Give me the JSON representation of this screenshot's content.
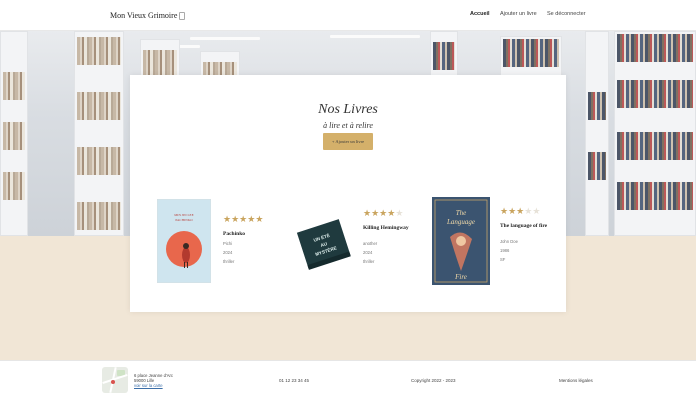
{
  "header": {
    "logo_text": "Mon Vieux Grimoire",
    "nav": [
      {
        "label": "Accueil",
        "active": true
      },
      {
        "label": "Ajouter un livre",
        "active": false
      },
      {
        "label": "Se déconnecter",
        "active": false
      }
    ]
  },
  "hero": {
    "title": "Nos Livres",
    "subtitle": "à lire et à relire",
    "add_button": "+ Ajouter un livre"
  },
  "books": [
    {
      "title": "Pachinko",
      "author": "Pichi",
      "year": "2024",
      "genre": "thriller",
      "rating": 5,
      "cover_text": "MIN JIN LEE PACHINKO"
    },
    {
      "title": "Killing Hemingway",
      "author": "another",
      "year": "2024",
      "genre": "thriller",
      "rating": 4,
      "cover_text": "UN ÉTÉ AU MYSTÈRE"
    },
    {
      "title": "The language of fire",
      "author": "John Doe",
      "year": "1986",
      "genre": "SF",
      "rating": 3,
      "cover_text": "The Language of Fire"
    }
  ],
  "footer": {
    "address_line1": "6 place Jeanne d'Arc",
    "address_line2": "59000 Lille",
    "map_link": "voir sur la carte",
    "phone": "01 12 23 34 45",
    "copyright": "Copyright 2022 - 2023",
    "legal": "Mentions légales"
  },
  "colors": {
    "accent": "#d4b06a",
    "star_on": "#c9a45e",
    "star_off": "#e7e2d8",
    "page_bg": "#f1e6d6"
  }
}
